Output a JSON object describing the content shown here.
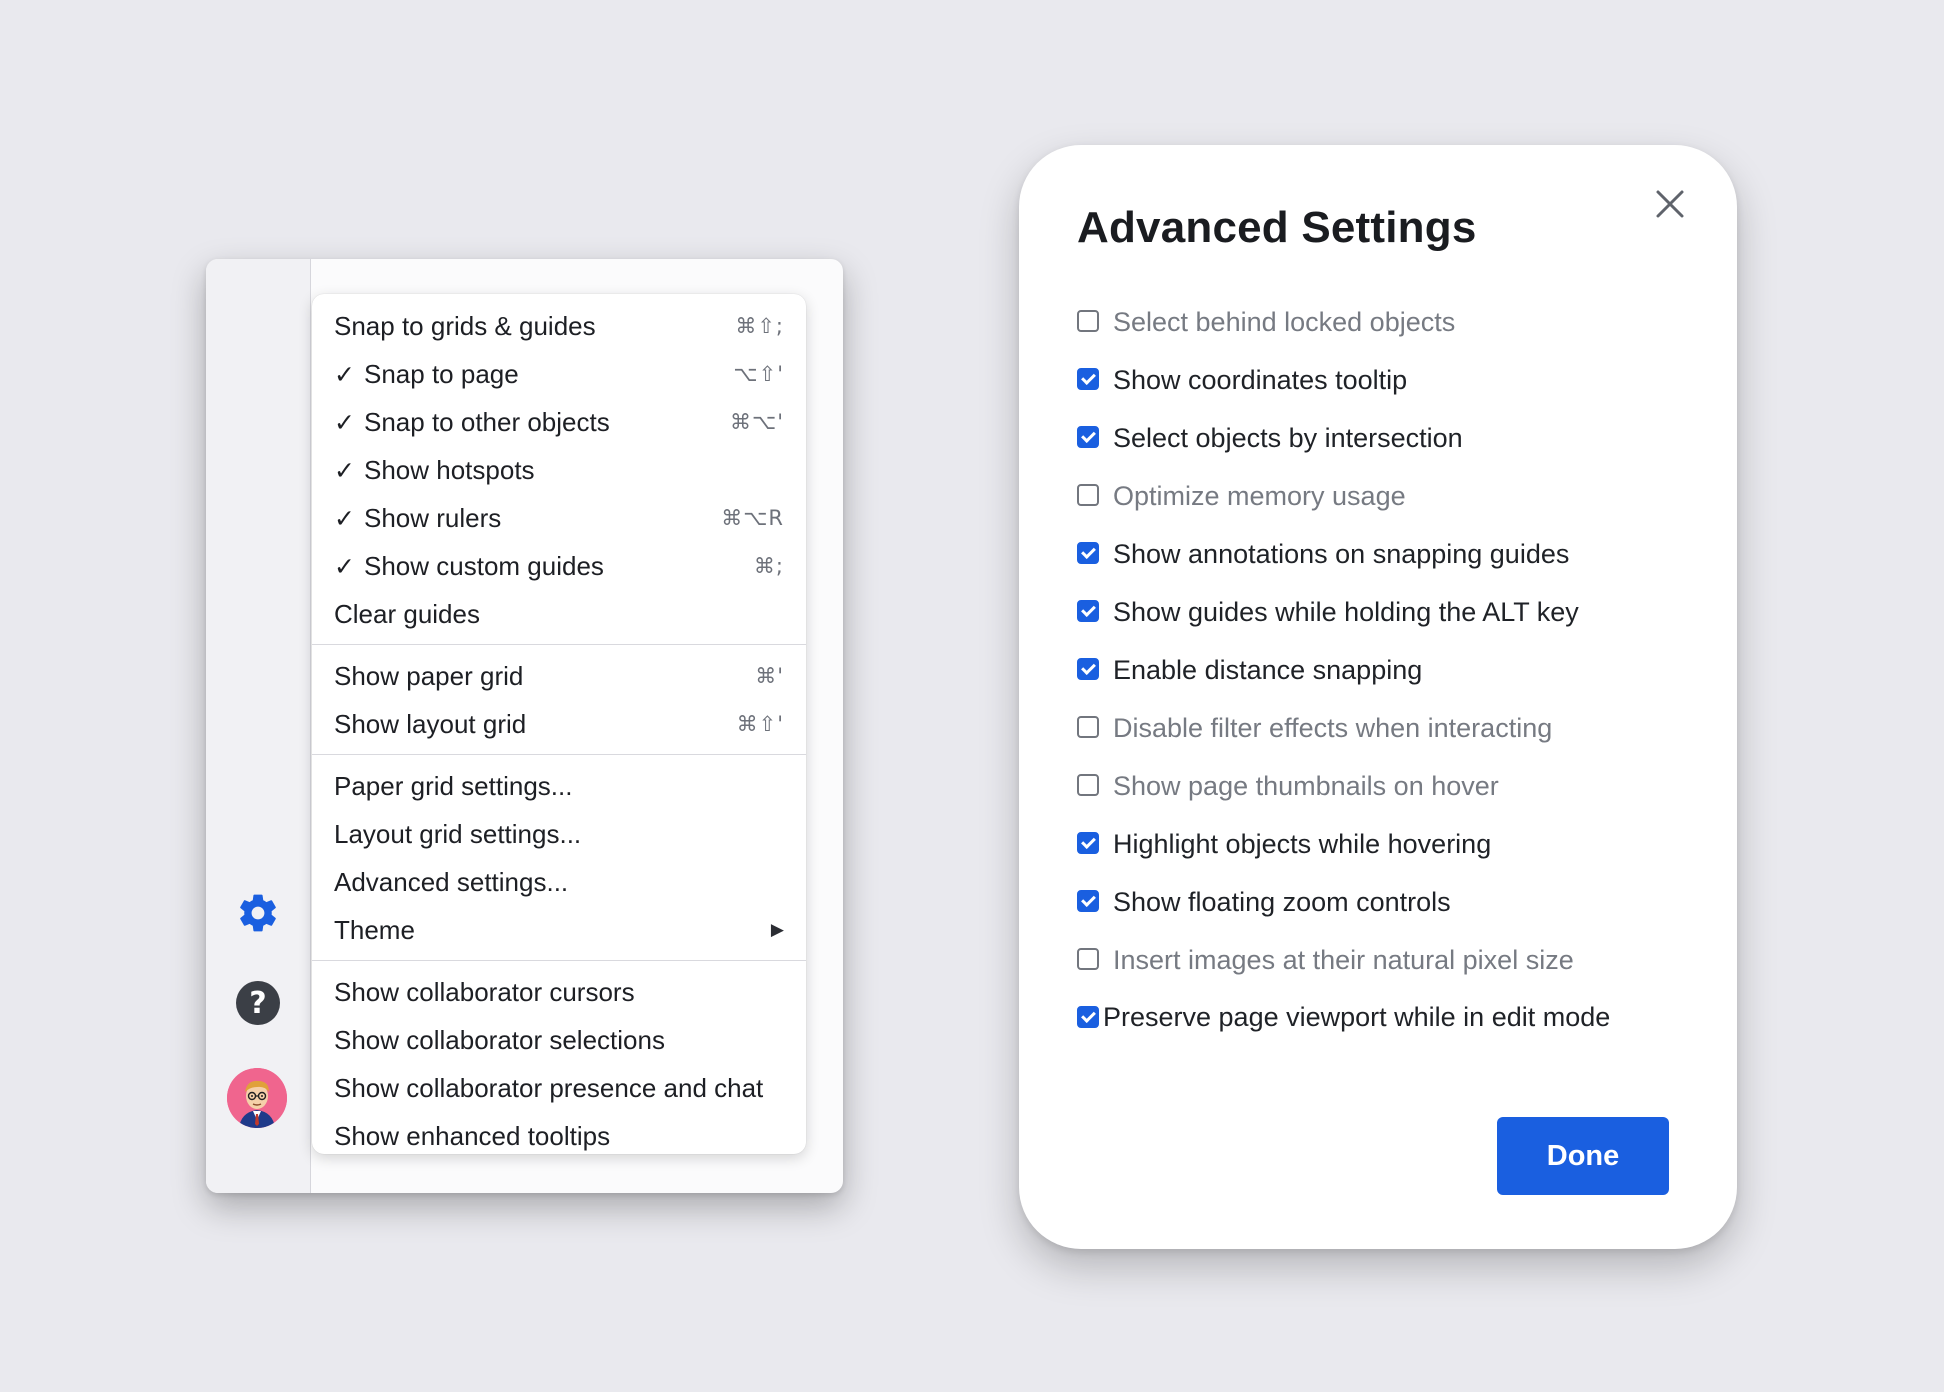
{
  "menu": {
    "groups": [
      [
        {
          "label": "Snap to grids & guides",
          "checked": "",
          "shortcut": "⌘⇧;"
        },
        {
          "label": "Snap to page",
          "checked": "✓",
          "shortcut": "⌥⇧'"
        },
        {
          "label": "Snap to other objects",
          "checked": "✓",
          "shortcut": "⌘⌥'"
        },
        {
          "label": "Show hotspots",
          "checked": "✓",
          "shortcut": ""
        },
        {
          "label": "Show rulers",
          "checked": "✓",
          "shortcut": "⌘⌥R"
        },
        {
          "label": "Show custom guides",
          "checked": "✓",
          "shortcut": "⌘;"
        },
        {
          "label": "Clear guides",
          "checked": "",
          "shortcut": ""
        }
      ],
      [
        {
          "label": "Show paper grid",
          "checked": "",
          "shortcut": "⌘'"
        },
        {
          "label": "Show layout grid",
          "checked": "",
          "shortcut": "⌘⇧'"
        }
      ],
      [
        {
          "label": "Paper grid settings...",
          "checked": "",
          "shortcut": ""
        },
        {
          "label": "Layout grid settings...",
          "checked": "",
          "shortcut": ""
        },
        {
          "label": "Advanced settings...",
          "checked": "",
          "shortcut": ""
        },
        {
          "label": "Theme",
          "checked": "",
          "shortcut": "",
          "submenu": "▶"
        }
      ],
      [
        {
          "label": "Show collaborator cursors",
          "checked": "",
          "shortcut": ""
        },
        {
          "label": "Show collaborator selections",
          "checked": "",
          "shortcut": ""
        },
        {
          "label": "Show collaborator presence and chat",
          "checked": "",
          "shortcut": ""
        },
        {
          "label": "Show enhanced tooltips",
          "checked": "",
          "shortcut": ""
        }
      ]
    ]
  },
  "sidebar": {
    "icons": [
      "gear-icon",
      "help-icon",
      "avatar"
    ],
    "help_glyph": "?",
    "accent_color": "#1a5fe0"
  },
  "dialog": {
    "title": "Advanced Settings",
    "close_icon": "close-icon",
    "options": [
      {
        "label": "Select behind locked objects",
        "checked": false
      },
      {
        "label": "Show coordinates tooltip",
        "checked": true
      },
      {
        "label": "Select objects by intersection",
        "checked": true
      },
      {
        "label": "Optimize memory usage",
        "checked": false
      },
      {
        "label": "Show annotations on snapping guides",
        "checked": true
      },
      {
        "label": "Show guides while holding the ALT key",
        "checked": true
      },
      {
        "label": "Enable distance snapping",
        "checked": true
      },
      {
        "label": "Disable filter effects when interacting",
        "checked": false
      },
      {
        "label": "Show page thumbnails on hover",
        "checked": false
      },
      {
        "label": "Highlight objects while hovering",
        "checked": true
      },
      {
        "label": "Show floating zoom controls",
        "checked": true
      },
      {
        "label": "Insert images at their natural pixel size",
        "checked": false
      },
      {
        "label": "Preserve page viewport while in edit mode",
        "checked": true
      }
    ],
    "done_label": "Done",
    "accent_color": "#1a5fe0"
  }
}
